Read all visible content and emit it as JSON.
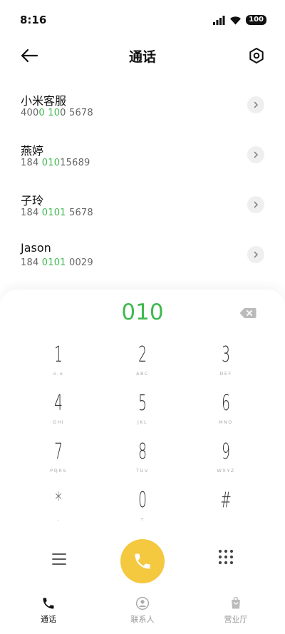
{
  "status": {
    "time": "8:16",
    "battery": "100"
  },
  "header": {
    "title": "通话"
  },
  "contacts": [
    {
      "name": "小米客服",
      "number": {
        "pre": "400",
        "hl1": "0 10",
        "post": "0 5678"
      }
    },
    {
      "name": "燕婷",
      "number": {
        "pre": "184 ",
        "hl1": "010",
        "post": "15689"
      }
    },
    {
      "name": "子玲",
      "number": {
        "pre": "184 ",
        "hl1": "0101",
        "post": " 5678"
      }
    },
    {
      "name": "Jason",
      "number": {
        "pre": "184 ",
        "hl1": "0101",
        "post": " 0029"
      }
    }
  ],
  "dialpad": {
    "typed": "010",
    "keys": [
      {
        "digit": "1",
        "letters": "o.o"
      },
      {
        "digit": "2",
        "letters": "ABC"
      },
      {
        "digit": "3",
        "letters": "DEF"
      },
      {
        "digit": "4",
        "letters": "GHI"
      },
      {
        "digit": "5",
        "letters": "JKL"
      },
      {
        "digit": "6",
        "letters": "MNO"
      },
      {
        "digit": "7",
        "letters": "PQRS"
      },
      {
        "digit": "8",
        "letters": "TUV"
      },
      {
        "digit": "9",
        "letters": "WXYZ"
      },
      {
        "digit": "*",
        "letters": ","
      },
      {
        "digit": "0",
        "letters": "+"
      },
      {
        "digit": "#",
        "letters": ""
      }
    ]
  },
  "tabs": [
    {
      "label": "通话"
    },
    {
      "label": "联系人"
    },
    {
      "label": "营业厅"
    }
  ],
  "colors": {
    "accent": "#3fb950",
    "call": "#f4c83f"
  }
}
